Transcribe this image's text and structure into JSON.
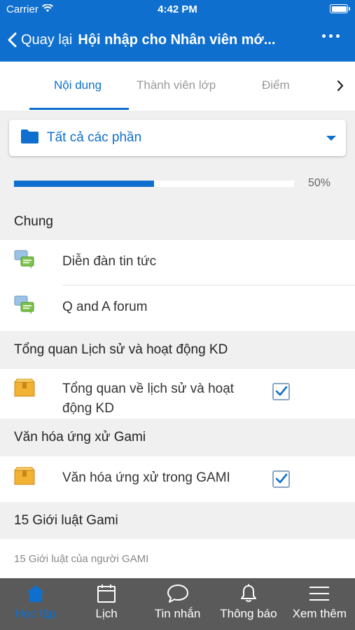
{
  "status_bar": {
    "carrier": "Carrier",
    "time": "4:42 PM"
  },
  "navbar": {
    "back_label": "Quay lại",
    "title": "Hội nhập cho Nhân viên mớ..."
  },
  "tabs": [
    {
      "label": "Nội dung",
      "active": true
    },
    {
      "label": "Thành viên lớp",
      "active": false
    },
    {
      "label": "Điểm",
      "active": false
    }
  ],
  "section_filter": {
    "label": "Tất cả các phần"
  },
  "progress": {
    "value": 0.5,
    "label": "50%"
  },
  "sections": [
    {
      "title": "Chung",
      "items": [
        {
          "label": "Diễn đàn tin tức",
          "icon": "forum-icon"
        },
        {
          "label": "Q and A forum",
          "icon": "forum-icon"
        }
      ]
    },
    {
      "title": "Tổng quan Lịch sử và hoạt động KD",
      "items": [
        {
          "label_line1": "Tổng quan về lịch sử và hoạt",
          "label_line2": "động KD",
          "icon": "package-icon",
          "completed": true
        }
      ]
    },
    {
      "title": "Văn hóa ứng xử Gami",
      "items": [
        {
          "label": "Văn hóa ứng xử trong GAMI",
          "icon": "package-icon",
          "completed": true
        }
      ]
    },
    {
      "title": "15 Giới luật Gami",
      "summary": "15 Giới luật của người GAMI"
    }
  ],
  "bottom_tabs": [
    {
      "label": "Học tập",
      "icon": "home-icon",
      "active": true
    },
    {
      "label": "Lịch",
      "icon": "calendar-icon",
      "active": false
    },
    {
      "label": "Tin nhắn",
      "icon": "chat-icon",
      "active": false
    },
    {
      "label": "Thông báo",
      "icon": "bell-icon",
      "active": false
    },
    {
      "label": "Xem thêm",
      "icon": "menu-icon",
      "active": false
    }
  ],
  "colors": {
    "brand": "#0f6fce",
    "tabbar_bg": "#5a5a5a",
    "section_bg": "#f0f0f0"
  }
}
